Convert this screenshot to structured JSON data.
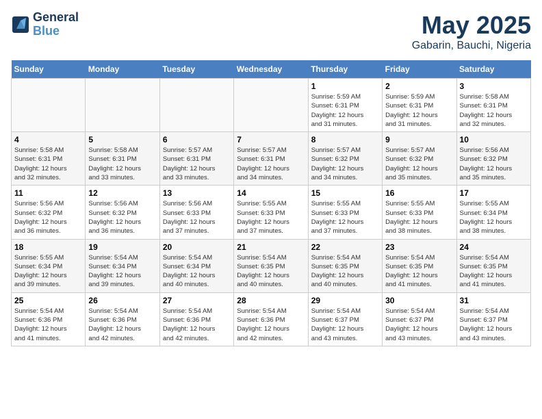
{
  "header": {
    "logo_line1": "General",
    "logo_line2": "Blue",
    "month": "May 2025",
    "location": "Gabarin, Bauchi, Nigeria"
  },
  "weekdays": [
    "Sunday",
    "Monday",
    "Tuesday",
    "Wednesday",
    "Thursday",
    "Friday",
    "Saturday"
  ],
  "weeks": [
    [
      {
        "day": "",
        "info": ""
      },
      {
        "day": "",
        "info": ""
      },
      {
        "day": "",
        "info": ""
      },
      {
        "day": "",
        "info": ""
      },
      {
        "day": "1",
        "info": "Sunrise: 5:59 AM\nSunset: 6:31 PM\nDaylight: 12 hours\nand 31 minutes."
      },
      {
        "day": "2",
        "info": "Sunrise: 5:59 AM\nSunset: 6:31 PM\nDaylight: 12 hours\nand 31 minutes."
      },
      {
        "day": "3",
        "info": "Sunrise: 5:58 AM\nSunset: 6:31 PM\nDaylight: 12 hours\nand 32 minutes."
      }
    ],
    [
      {
        "day": "4",
        "info": "Sunrise: 5:58 AM\nSunset: 6:31 PM\nDaylight: 12 hours\nand 32 minutes."
      },
      {
        "day": "5",
        "info": "Sunrise: 5:58 AM\nSunset: 6:31 PM\nDaylight: 12 hours\nand 33 minutes."
      },
      {
        "day": "6",
        "info": "Sunrise: 5:57 AM\nSunset: 6:31 PM\nDaylight: 12 hours\nand 33 minutes."
      },
      {
        "day": "7",
        "info": "Sunrise: 5:57 AM\nSunset: 6:31 PM\nDaylight: 12 hours\nand 34 minutes."
      },
      {
        "day": "8",
        "info": "Sunrise: 5:57 AM\nSunset: 6:32 PM\nDaylight: 12 hours\nand 34 minutes."
      },
      {
        "day": "9",
        "info": "Sunrise: 5:57 AM\nSunset: 6:32 PM\nDaylight: 12 hours\nand 35 minutes."
      },
      {
        "day": "10",
        "info": "Sunrise: 5:56 AM\nSunset: 6:32 PM\nDaylight: 12 hours\nand 35 minutes."
      }
    ],
    [
      {
        "day": "11",
        "info": "Sunrise: 5:56 AM\nSunset: 6:32 PM\nDaylight: 12 hours\nand 36 minutes."
      },
      {
        "day": "12",
        "info": "Sunrise: 5:56 AM\nSunset: 6:32 PM\nDaylight: 12 hours\nand 36 minutes."
      },
      {
        "day": "13",
        "info": "Sunrise: 5:56 AM\nSunset: 6:33 PM\nDaylight: 12 hours\nand 37 minutes."
      },
      {
        "day": "14",
        "info": "Sunrise: 5:55 AM\nSunset: 6:33 PM\nDaylight: 12 hours\nand 37 minutes."
      },
      {
        "day": "15",
        "info": "Sunrise: 5:55 AM\nSunset: 6:33 PM\nDaylight: 12 hours\nand 37 minutes."
      },
      {
        "day": "16",
        "info": "Sunrise: 5:55 AM\nSunset: 6:33 PM\nDaylight: 12 hours\nand 38 minutes."
      },
      {
        "day": "17",
        "info": "Sunrise: 5:55 AM\nSunset: 6:34 PM\nDaylight: 12 hours\nand 38 minutes."
      }
    ],
    [
      {
        "day": "18",
        "info": "Sunrise: 5:55 AM\nSunset: 6:34 PM\nDaylight: 12 hours\nand 39 minutes."
      },
      {
        "day": "19",
        "info": "Sunrise: 5:54 AM\nSunset: 6:34 PM\nDaylight: 12 hours\nand 39 minutes."
      },
      {
        "day": "20",
        "info": "Sunrise: 5:54 AM\nSunset: 6:34 PM\nDaylight: 12 hours\nand 40 minutes."
      },
      {
        "day": "21",
        "info": "Sunrise: 5:54 AM\nSunset: 6:35 PM\nDaylight: 12 hours\nand 40 minutes."
      },
      {
        "day": "22",
        "info": "Sunrise: 5:54 AM\nSunset: 6:35 PM\nDaylight: 12 hours\nand 40 minutes."
      },
      {
        "day": "23",
        "info": "Sunrise: 5:54 AM\nSunset: 6:35 PM\nDaylight: 12 hours\nand 41 minutes."
      },
      {
        "day": "24",
        "info": "Sunrise: 5:54 AM\nSunset: 6:35 PM\nDaylight: 12 hours\nand 41 minutes."
      }
    ],
    [
      {
        "day": "25",
        "info": "Sunrise: 5:54 AM\nSunset: 6:36 PM\nDaylight: 12 hours\nand 41 minutes."
      },
      {
        "day": "26",
        "info": "Sunrise: 5:54 AM\nSunset: 6:36 PM\nDaylight: 12 hours\nand 42 minutes."
      },
      {
        "day": "27",
        "info": "Sunrise: 5:54 AM\nSunset: 6:36 PM\nDaylight: 12 hours\nand 42 minutes."
      },
      {
        "day": "28",
        "info": "Sunrise: 5:54 AM\nSunset: 6:36 PM\nDaylight: 12 hours\nand 42 minutes."
      },
      {
        "day": "29",
        "info": "Sunrise: 5:54 AM\nSunset: 6:37 PM\nDaylight: 12 hours\nand 43 minutes."
      },
      {
        "day": "30",
        "info": "Sunrise: 5:54 AM\nSunset: 6:37 PM\nDaylight: 12 hours\nand 43 minutes."
      },
      {
        "day": "31",
        "info": "Sunrise: 5:54 AM\nSunset: 6:37 PM\nDaylight: 12 hours\nand 43 minutes."
      }
    ]
  ]
}
